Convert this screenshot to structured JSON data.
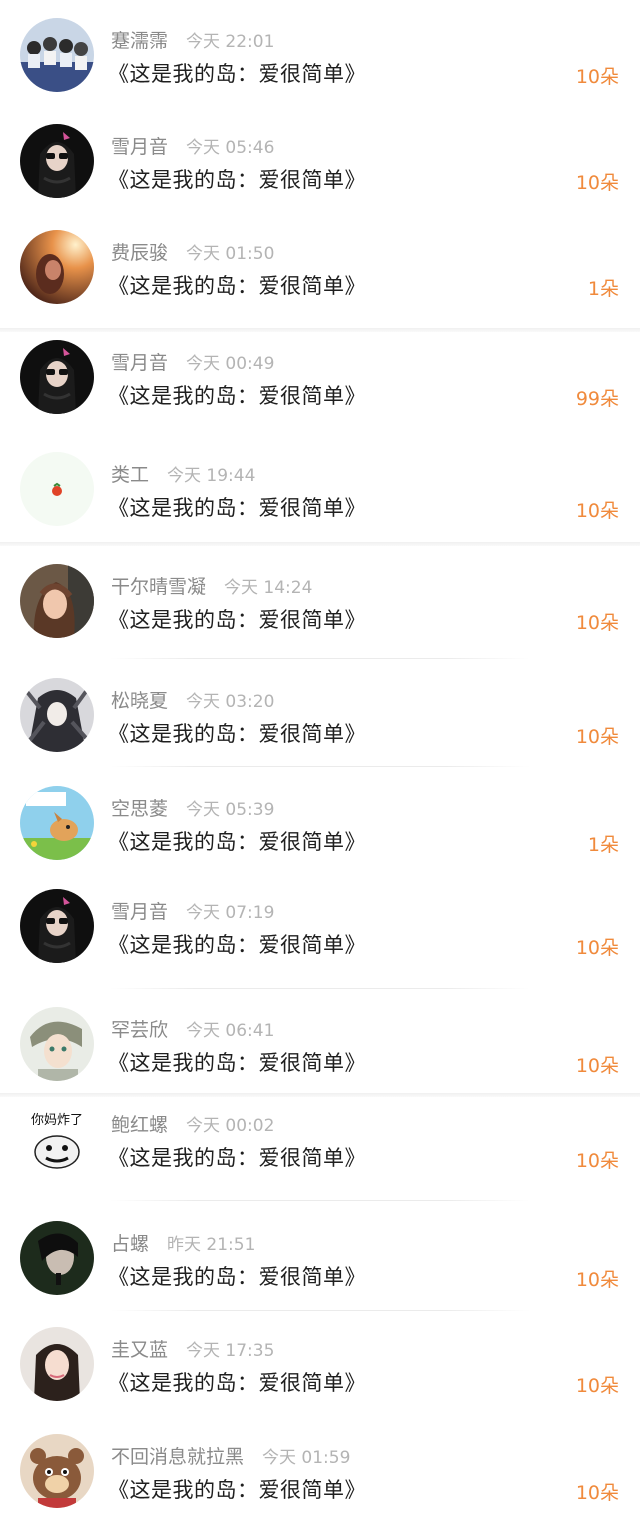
{
  "gift_records": [
    {
      "name": "蹇濡霈",
      "time": "今天 22:01",
      "gift": "《这是我的岛：爱很简单》",
      "count": "10朵",
      "avatar": "group-photo-avatar"
    },
    {
      "name": "雪月音",
      "time": "今天 05:46",
      "gift": "《这是我的岛：爱很简单》",
      "count": "10朵",
      "avatar": "girl-sunglasses-avatar"
    },
    {
      "name": "费辰骏",
      "time": "今天 01:50",
      "gift": "《这是我的岛：爱很简单》",
      "count": "1朵",
      "avatar": "sunset-portrait-avatar"
    },
    {
      "name": "雪月音",
      "time": "今天 00:49",
      "gift": "《这是我的岛：爱很简单》",
      "count": "99朵",
      "avatar": "girl-sunglasses-avatar"
    },
    {
      "name": "类工",
      "time": "今天 19:44",
      "gift": "《这是我的岛：爱很简单》",
      "count": "10朵",
      "avatar": "tomato-avatar"
    },
    {
      "name": "干尔晴雪凝",
      "time": "今天 14:24",
      "gift": "《这是我的岛：爱很简单》",
      "count": "10朵",
      "avatar": "girl-portrait-avatar"
    },
    {
      "name": "松晓夏",
      "time": "今天 03:20",
      "gift": "《这是我的岛：爱很简单》",
      "count": "10朵",
      "avatar": "anime-dark-avatar"
    },
    {
      "name": "空思菱",
      "time": "今天 05:39",
      "gift": "《这是我的岛：爱很简单》",
      "count": "1朵",
      "avatar": "cartoon-dog-avatar"
    },
    {
      "name": "雪月音",
      "time": "今天 07:19",
      "gift": "《这是我的岛：爱很简单》",
      "count": "10朵",
      "avatar": "girl-sunglasses-avatar"
    },
    {
      "name": "罕芸欣",
      "time": "今天 06:41",
      "gift": "《这是我的岛：爱很简单》",
      "count": "10朵",
      "avatar": "anime-boy-avatar"
    },
    {
      "name": "鲍红螺",
      "time": "今天 00:02",
      "gift": "《这是我的岛：爱很简单》",
      "count": "10朵",
      "avatar": "meme-avatar"
    },
    {
      "name": "占螺",
      "time": "昨天 21:51",
      "gift": "《这是我的岛：爱很简单》",
      "count": "10朵",
      "avatar": "dark-portrait-avatar"
    },
    {
      "name": "圭又蓝",
      "time": "今天 17:35",
      "gift": "《这是我的岛：爱很简单》",
      "count": "10朵",
      "avatar": "long-hair-girl-avatar"
    },
    {
      "name": "不回消息就拉黑",
      "time": "今天 01:59",
      "gift": "《这是我的岛：爱很简单》",
      "count": "10朵",
      "avatar": "cartoon-bear-avatar"
    }
  ],
  "meme_avatar_text": "你妈炸了"
}
